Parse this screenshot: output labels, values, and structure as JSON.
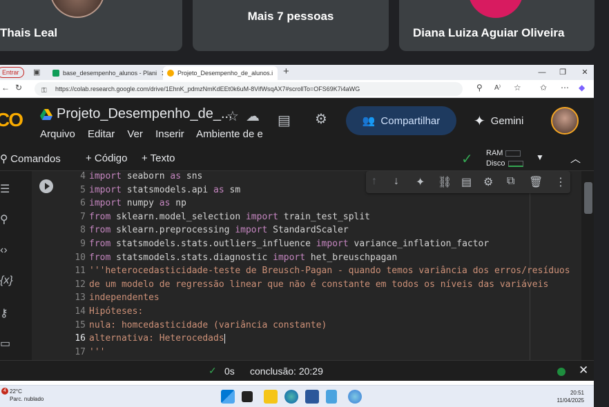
{
  "meet": {
    "tiles": [
      {
        "name": "Thais Leal"
      },
      {
        "name": "Mais 7 pessoas"
      },
      {
        "name": "Diana Luiza Aguiar Oliveira"
      }
    ]
  },
  "browser": {
    "entrar_label": "Entrar",
    "tabs": [
      {
        "label": "base_desempenho_alunos - Plani"
      },
      {
        "label": "Projeto_Desempenho_de_alunos.i"
      }
    ],
    "url": "https://colab.research.google.com/drive/1EhnK_pdmzNmKdEEt0k6uM-8VifWsqAX7#scrollTo=OFS69K7i4aWG"
  },
  "colab": {
    "logo": "CO",
    "title": "Projeto_Desempenho_de_...",
    "menu": [
      "Arquivo",
      "Editar",
      "Ver",
      "Inserir",
      "Ambiente de e:"
    ],
    "share_label": "Compartilhar",
    "gemini_label": "Gemini",
    "toolbar": {
      "commands": "Comandos",
      "add_code": "+ Código",
      "add_text": "+ Texto",
      "ram_label": "RAM",
      "disk_label": "Disco"
    }
  },
  "code_lines": [
    {
      "n": "4",
      "parts": [
        [
          "kw",
          "import"
        ],
        [
          "tx",
          " seaborn "
        ],
        [
          "kw",
          "as"
        ],
        [
          "tx",
          " sns"
        ]
      ]
    },
    {
      "n": "5",
      "parts": [
        [
          "kw",
          "import"
        ],
        [
          "tx",
          " statsmodels.api "
        ],
        [
          "kw",
          "as"
        ],
        [
          "tx",
          " sm"
        ]
      ]
    },
    {
      "n": "6",
      "parts": [
        [
          "kw",
          "import"
        ],
        [
          "tx",
          " numpy "
        ],
        [
          "kw",
          "as"
        ],
        [
          "tx",
          " np"
        ]
      ]
    },
    {
      "n": "7",
      "parts": [
        [
          "kw",
          "from"
        ],
        [
          "tx",
          " sklearn.model_selection "
        ],
        [
          "kw",
          "import"
        ],
        [
          "tx",
          " train_test_split"
        ]
      ]
    },
    {
      "n": "8",
      "parts": [
        [
          "kw",
          "from"
        ],
        [
          "tx",
          " sklearn.preprocessing "
        ],
        [
          "kw",
          "import"
        ],
        [
          "tx",
          " StandardScaler"
        ]
      ]
    },
    {
      "n": "9",
      "parts": [
        [
          "kw",
          "from"
        ],
        [
          "tx",
          " statsmodels.stats.outliers_influence "
        ],
        [
          "kw",
          "import"
        ],
        [
          "tx",
          " variance_inflation_factor"
        ]
      ]
    },
    {
      "n": "10",
      "parts": [
        [
          "kw",
          "from"
        ],
        [
          "tx",
          " statsmodels.stats.diagnostic "
        ],
        [
          "kw",
          "import"
        ],
        [
          "tx",
          " het_breuschpagan"
        ]
      ]
    },
    {
      "n": "11",
      "parts": [
        [
          "st",
          "'''heterocedasticidade-teste de Breusch-Pagan - quando temos variância dos erros/resíduos"
        ]
      ]
    },
    {
      "n": "12",
      "parts": [
        [
          "st",
          "de um modelo de regressão linear que não é constante em todos os níveis das variáveis"
        ]
      ]
    },
    {
      "n": "13",
      "parts": [
        [
          "st",
          "independentes"
        ]
      ]
    },
    {
      "n": "14",
      "parts": [
        [
          "st",
          "Hipóteses:"
        ]
      ]
    },
    {
      "n": "15",
      "parts": [
        [
          "st",
          "nula: homcedasticidade (variância constante)"
        ]
      ]
    },
    {
      "n": "16",
      "parts": [
        [
          "st",
          "alternativa: Heterocedads"
        ]
      ]
    },
    {
      "n": "17",
      "parts": [
        [
          "st",
          "'''"
        ]
      ]
    }
  ],
  "status": {
    "elapsed": "0s",
    "completion": "conclusão: 20:29"
  },
  "taskbar": {
    "weather_temp": "22°C",
    "weather_desc": "Parc. nublado",
    "weather_badge": "4",
    "time": "20:51",
    "date": "11/04/2025"
  }
}
